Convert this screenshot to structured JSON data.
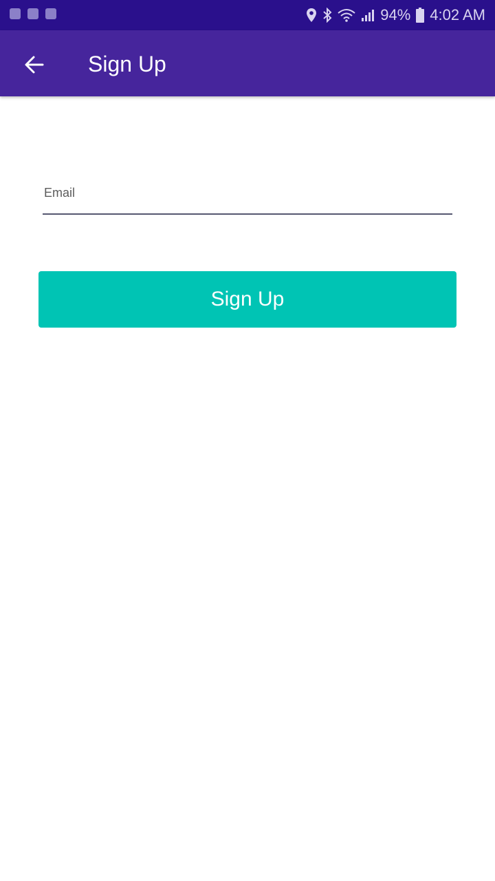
{
  "status_bar": {
    "battery": "94%",
    "time": "4:02 AM",
    "icons": [
      "location-icon",
      "bluetooth-icon",
      "wifi-icon",
      "signal-icon",
      "battery-icon"
    ]
  },
  "header": {
    "back_icon": "arrow-left-icon",
    "title": "Sign Up"
  },
  "form": {
    "email_label": "Email",
    "email_value": "",
    "signup_button_label": "Sign Up"
  },
  "colors": {
    "status_bar": "#2a108c",
    "app_bar": "#46259c",
    "button": "#00c4b4",
    "background": "#ffffff"
  }
}
